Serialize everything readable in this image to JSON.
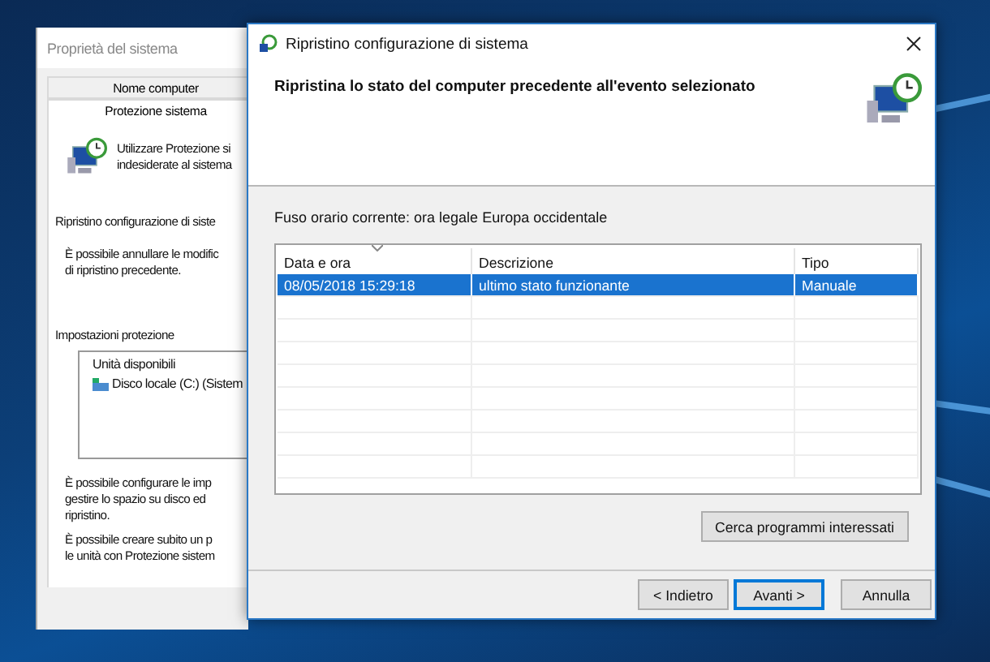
{
  "back_window": {
    "title": "Proprietà del sistema",
    "tabs": [
      {
        "label": "Nome computer",
        "selected": false
      },
      {
        "label": "Protezione sistema",
        "selected": true
      }
    ],
    "intro_lines": [
      "Utilizzare Protezione si",
      "indesiderate al sistema"
    ],
    "restore_title": "Ripristino configurazione di siste",
    "restore_lines": [
      "È possibile annullare le modific",
      "di ripristino precedente."
    ],
    "settings_title": "Impostazioni protezione",
    "list_header": "Unità disponibili",
    "drives": [
      {
        "label": "Disco locale (C:) (Sistem"
      }
    ],
    "notes": [
      [
        "È possibile configurare le imp",
        "gestire lo spazio su disco ed",
        "ripristino."
      ],
      [
        "È possibile creare subito un p",
        "le unità con Protezione sistem"
      ]
    ]
  },
  "front_window": {
    "title": "Ripristino configurazione di sistema",
    "heading": "Ripristina lo stato del computer precedente all'evento selezionato",
    "timezone": "Fuso orario corrente: ora legale Europa occidentale",
    "table": {
      "columns": [
        {
          "label": "Data e ora",
          "sorted": true
        },
        {
          "label": "Descrizione",
          "sorted": false
        },
        {
          "label": "Tipo",
          "sorted": false
        }
      ],
      "rows": [
        {
          "cells": [
            "08/05/2018 15:29:18",
            "ultimo stato funzionante",
            "Manuale"
          ],
          "selected": true
        }
      ]
    },
    "search_button": "Cerca programmi interessati",
    "buttons": [
      {
        "label": "< Indietro",
        "default": false
      },
      {
        "label": "Avanti >",
        "default": true
      },
      {
        "label": "Annulla",
        "default": false
      }
    ]
  }
}
